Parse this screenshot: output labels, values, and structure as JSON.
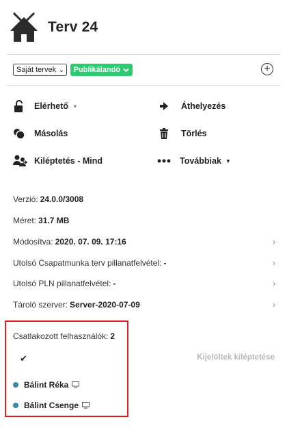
{
  "header": {
    "title": "Terv 24"
  },
  "toolbar": {
    "filter_select": "Saját tervek",
    "status_badge": "Publikálandó",
    "colors": {
      "status": "#2ecc71"
    }
  },
  "actions": {
    "available": "Elérhető",
    "move": "Áthelyezés",
    "copy": "Másolás",
    "delete": "Törlés",
    "logout_all": "Kiléptetés - Mind",
    "more": "Továbbiak"
  },
  "info": {
    "version_label": "Verzió:",
    "version_value": "24.0.0/3008",
    "size_label": "Méret:",
    "size_value": "31.7 MB",
    "modified_label": "Módosítva:",
    "modified_value": "2020. 07. 09. 17:16",
    "teamwork_snapshot_label": "Utolsó Csapatmunka terv pillanatfelvétel:",
    "teamwork_snapshot_value": "-",
    "pln_snapshot_label": "Utolsó PLN pillanatfelvétel:",
    "pln_snapshot_value": "-",
    "storage_label": "Tároló szerver:",
    "storage_value": "Server-2020-07-09"
  },
  "users": {
    "label": "Csatlakozott felhasználók:",
    "count": "2",
    "logout_selected": "Kijelöltek kiléptetése",
    "list": [
      {
        "name": "Bálint Réka"
      },
      {
        "name": "Bálint Csenge"
      }
    ],
    "colors": {
      "online_dot": "#3e86a6",
      "highlight_border": "#e02020"
    }
  }
}
